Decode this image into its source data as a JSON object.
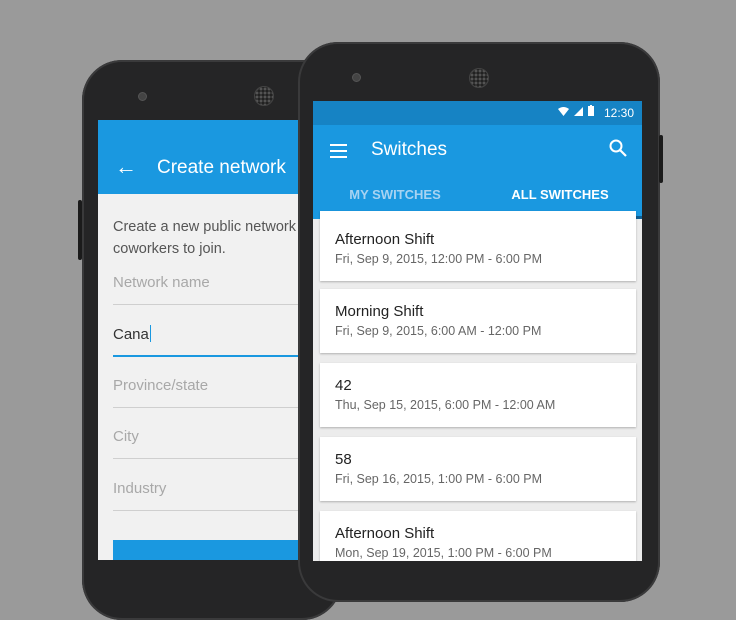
{
  "back_screen": {
    "title": "Create network",
    "back_icon": "arrow-back-icon",
    "description": "Create a new public network for your coworkers to join.",
    "fields": [
      {
        "placeholder": "Network name",
        "value": ""
      },
      {
        "placeholder": "",
        "value": "Cana"
      },
      {
        "placeholder": "Province/state",
        "value": ""
      },
      {
        "placeholder": "City",
        "value": ""
      },
      {
        "placeholder": "Industry",
        "value": ""
      }
    ]
  },
  "front_screen": {
    "status_time": "12:30",
    "status_icons": "wifi-icon signal-icon battery-icon",
    "title": "Switches",
    "menu_icon": "hamburger-menu-icon",
    "search_icon": "search-icon",
    "tabs": [
      {
        "label": "MY SWITCHES",
        "active": false
      },
      {
        "label": "ALL SWITCHES",
        "active": true
      }
    ],
    "shifts": [
      {
        "title": "Afternoon Shift",
        "subtitle": "Fri, Sep 9, 2015, 12:00 PM - 6:00 PM"
      },
      {
        "title": "Morning Shift",
        "subtitle": "Fri, Sep 9, 2015, 6:00 AM - 12:00 PM"
      },
      {
        "title": "42",
        "subtitle": "Thu, Sep 15, 2015, 6:00 PM - 12:00 AM"
      },
      {
        "title": "58",
        "subtitle": "Fri, Sep 16, 2015, 1:00 PM - 6:00 PM"
      },
      {
        "title": "Afternoon Shift",
        "subtitle": "Mon, Sep 19, 2015, 1:00 PM - 6:00 PM"
      }
    ]
  },
  "colors": {
    "background": "#9a9a9a",
    "primary": "#1a98e0",
    "primary_dark": "#1683c4",
    "tab_indicator": "#0f5f93"
  }
}
